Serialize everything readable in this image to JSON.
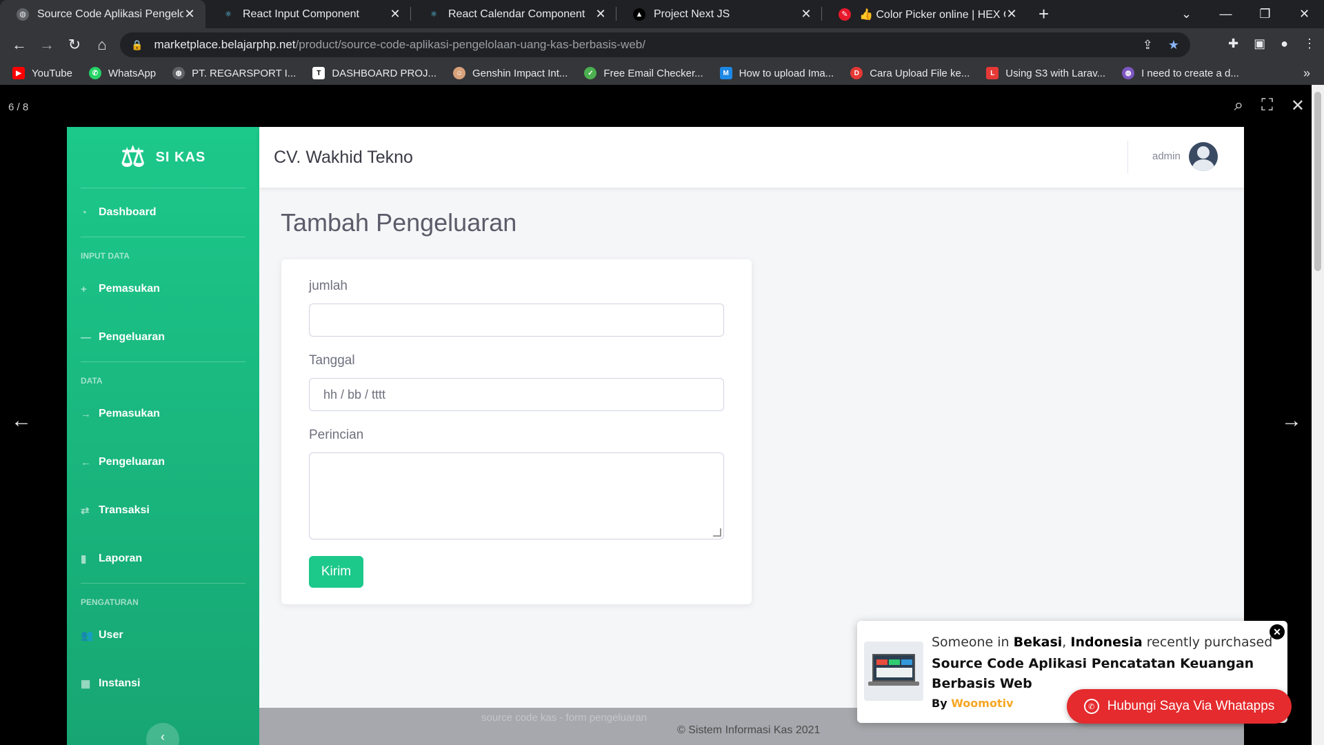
{
  "browser": {
    "tabs": [
      {
        "title": "Source Code Aplikasi Pengelolaan",
        "active": true,
        "icon": "globe-icon",
        "color": "#9aa0a6"
      },
      {
        "title": "React Input Component",
        "active": false,
        "icon": "react-icon",
        "color": "#61dafb"
      },
      {
        "title": "React Calendar Component",
        "active": false,
        "icon": "react-icon",
        "color": "#61dafb"
      },
      {
        "title": "Project Next JS",
        "active": false,
        "icon": "triangle-icon",
        "color": "#ffffff"
      },
      {
        "title": "👍 Color Picker online | HEX Colo",
        "active": false,
        "icon": "color-picker-icon",
        "color": "#e8192c"
      }
    ],
    "url_host": "marketplace.belajarphp.net",
    "url_path": "/product/source-code-aplikasi-pengelolaan-uang-kas-berbasis-web/",
    "bookmarks": [
      {
        "label": "YouTube",
        "color": "#ff0000",
        "icon": "youtube-icon"
      },
      {
        "label": "WhatsApp",
        "color": "#25d366",
        "icon": "whatsapp-icon"
      },
      {
        "label": "PT. REGARSPORT I...",
        "color": "#9aa0a6",
        "icon": "globe-icon"
      },
      {
        "label": "DASHBOARD PROJ...",
        "color": "#ffffff",
        "icon": "page-icon"
      },
      {
        "label": "Genshin Impact Int...",
        "color": "#d7a17a",
        "icon": "genshin-icon"
      },
      {
        "label": "Free Email Checker...",
        "color": "#4caf50",
        "icon": "check-icon"
      },
      {
        "label": "How to upload Ima...",
        "color": "#1e88e5",
        "icon": "m-icon"
      },
      {
        "label": "Cara Upload File ke...",
        "color": "#e53935",
        "icon": "dw-icon"
      },
      {
        "label": "Using S3 with Larav...",
        "color": "#e53935",
        "icon": "ln-icon"
      },
      {
        "label": "I need to create a d...",
        "color": "#7e57c2",
        "icon": "globe-icon"
      }
    ]
  },
  "viewer": {
    "counter": "6 / 8"
  },
  "app": {
    "brand": "SI KAS",
    "company": "CV. Wakhid Tekno",
    "user": "admin",
    "sidebar": {
      "dashboard": "Dashboard",
      "heading_input": "INPUT DATA",
      "input_pemasukan": "Pemasukan",
      "input_pengeluaran": "Pengeluaran",
      "heading_data": "DATA",
      "data_pemasukan": "Pemasukan",
      "data_pengeluaran": "Pengeluaran",
      "transaksi": "Transaksi",
      "laporan": "Laporan",
      "heading_pengaturan": "PENGATURAN",
      "user": "User",
      "instansi": "Instansi"
    },
    "page_title": "Tambah Pengeluaran",
    "form": {
      "jumlah_label": "jumlah",
      "jumlah_value": "",
      "tanggal_label": "Tanggal",
      "tanggal_placeholder": "hh / bb / tttt",
      "perincian_label": "Perincian",
      "perincian_value": "",
      "submit": "Kirim"
    },
    "footer": {
      "caption": "source code kas - form pengeluaran",
      "copyright": "© Sistem Informasi Kas 2021"
    }
  },
  "popup": {
    "line_prefix": "Someone in ",
    "city": "Bekasi",
    "country": "Indonesia",
    "line_suffix": " recently purchased",
    "product": "Source Code Aplikasi Pencatatan Keuangan Berbasis Web",
    "by_prefix": "By ",
    "by_author": "Woomotiv"
  },
  "whatsapp_button": "Hubungi Saya Via Whatapps",
  "colors": {
    "accent": "#1cc88a",
    "whatsapp_button": "#e52b2e"
  }
}
